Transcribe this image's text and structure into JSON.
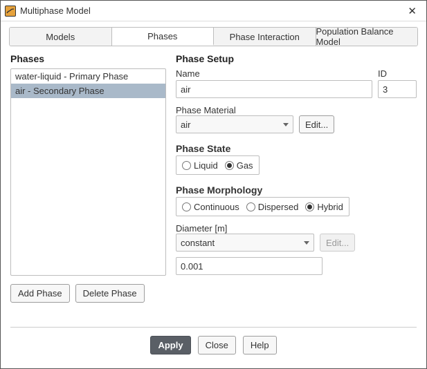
{
  "window": {
    "title": "Multiphase Model"
  },
  "tabs": [
    "Models",
    "Phases",
    "Phase Interaction",
    "Population Balance Model"
  ],
  "activeTab": 1,
  "left": {
    "title": "Phases",
    "items": [
      "water-liquid - Primary Phase",
      "air - Secondary Phase"
    ],
    "selectedIndex": 1,
    "addBtn": "Add Phase",
    "deleteBtn": "Delete Phase"
  },
  "setup": {
    "title": "Phase Setup",
    "nameLabel": "Name",
    "nameValue": "air",
    "idLabel": "ID",
    "idValue": "3",
    "materialLabel": "Phase Material",
    "materialValue": "air",
    "editBtn": "Edit...",
    "stateTitle": "Phase State",
    "stateOptions": [
      "Liquid",
      "Gas"
    ],
    "stateSelected": "Gas",
    "morphTitle": "Phase Morphology",
    "morphOptions": [
      "Continuous",
      "Dispersed",
      "Hybrid"
    ],
    "morphSelected": "Hybrid",
    "diameterLabel": "Diameter [m]",
    "diameterType": "constant",
    "diameterEdit": "Edit...",
    "diameterValue": "0.001"
  },
  "footer": {
    "apply": "Apply",
    "close": "Close",
    "help": "Help"
  }
}
